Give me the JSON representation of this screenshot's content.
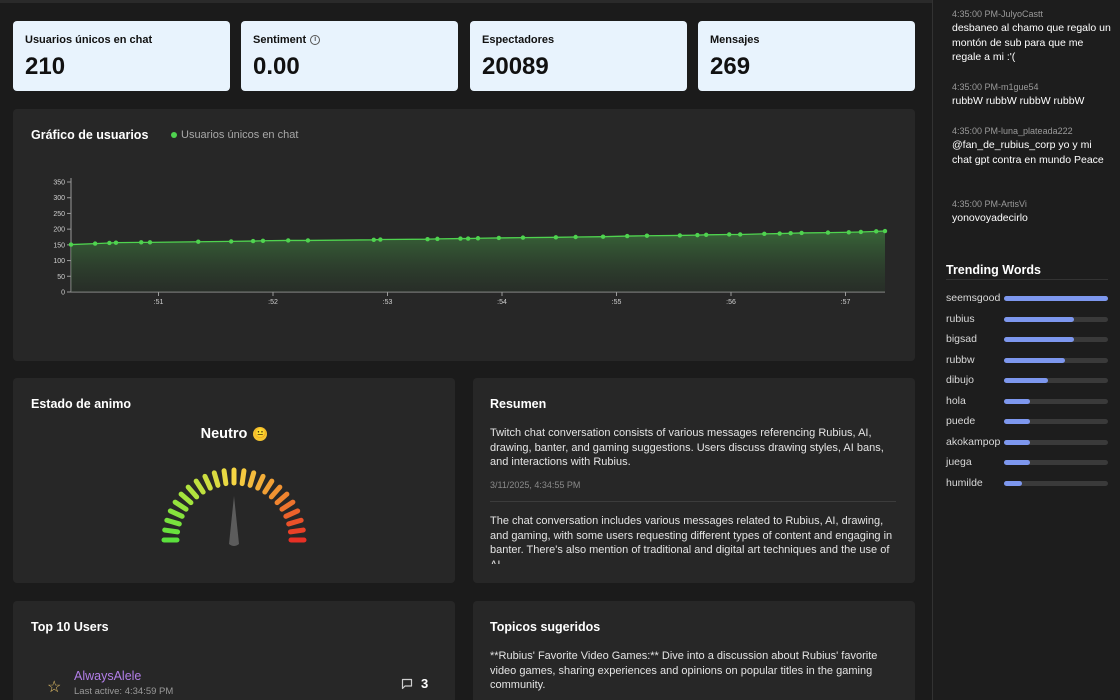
{
  "stats": [
    {
      "label": "Usuarios únicos en chat",
      "value": "210"
    },
    {
      "label": "Sentiment",
      "value": "0.00",
      "icon": "info-icon"
    },
    {
      "label": "Espectadores",
      "value": "20089"
    },
    {
      "label": "Mensajes",
      "value": "269"
    }
  ],
  "users_chart": {
    "title": "Gráfico de usuarios",
    "legend": "Usuarios únicos en chat"
  },
  "chart_data": {
    "type": "area",
    "title": "Gráfico de usuarios",
    "series": [
      {
        "name": "Usuarios únicos en chat",
        "color": "#4fd34f"
      }
    ],
    "y_ticks": [
      "350",
      "300",
      "250",
      "200",
      "150",
      "100",
      "50",
      "0"
    ],
    "x_ticks": [
      ":51",
      ":52",
      ":53",
      ":54",
      ":55",
      ":56",
      ":57"
    ],
    "ylim": [
      0,
      350
    ],
    "x": [
      0.0,
      0.22,
      0.35,
      0.41,
      0.64,
      0.72,
      1.16,
      1.46,
      1.66,
      1.75,
      1.98,
      2.16,
      2.76,
      2.82,
      3.25,
      3.34,
      3.55,
      3.62,
      3.71,
      3.9,
      4.12,
      4.42,
      4.6,
      4.85,
      5.07,
      5.25,
      5.55,
      5.71,
      5.79,
      6.0,
      6.1,
      6.32,
      6.46,
      6.56,
      6.66,
      6.9,
      7.09,
      7.2,
      7.34,
      7.42
    ],
    "values": [
      151,
      154,
      156,
      157,
      158,
      158,
      160,
      161,
      162,
      163,
      164,
      164,
      166,
      167,
      168,
      169,
      170,
      170,
      171,
      172,
      173,
      174,
      175,
      176,
      178,
      179,
      180,
      181,
      182,
      183,
      183,
      185,
      186,
      187,
      188,
      189,
      190,
      191,
      193,
      194
    ],
    "x_start_label": ":51",
    "x_unit": "minutes past 4:50"
  },
  "mood": {
    "title": "Estado de animo",
    "label": "Neutro",
    "emoji": "😐"
  },
  "summary": {
    "title": "Resumen",
    "items": [
      {
        "text": "Twitch chat conversation consists of various messages referencing Rubius, AI, drawing, banter, and gaming suggestions. Users discuss drawing styles, AI bans, and interactions with Rubius.",
        "date": "3/11/2025, 4:34:55 PM"
      },
      {
        "text": "The chat conversation includes various messages related to Rubius, AI, drawing, and gaming, with some users requesting different types of content and engaging in banter. There's also mention of traditional and digital art techniques and the use of AI."
      }
    ]
  },
  "top_users": {
    "title": "Top 10 Users",
    "users": [
      {
        "name": "AlwaysAlele",
        "last_active": "Last active: 4:34:59 PM",
        "count": "3"
      }
    ]
  },
  "topics": {
    "title": "Topicos sugeridos",
    "text": "**Rubius' Favorite Video Games:** Dive into a discussion about Rubius' favorite video games, sharing experiences and opinions on popular titles in the gaming community."
  },
  "chat": [
    {
      "meta": "4:35:00 PM-JulyoCastt",
      "text": "desbaneo al chamo que regalo un montón de sub para que me regale a mi :'("
    },
    {
      "meta": "4:35:00 PM-m1gue54",
      "text": "rubbW rubbW rubbW rubbW"
    },
    {
      "meta": "4:35:00 PM-luna_plateada222",
      "text": "@fan_de_rubius_corp yo y mi chat gpt contra en mundo Peace"
    },
    {
      "meta": "4:35:00 PM-ArtisVi",
      "text": "yonovoyadecirlo"
    }
  ],
  "trending": {
    "title": "Trending Words",
    "words": [
      {
        "word": "seemsgood",
        "level": 1.0
      },
      {
        "word": "rubius",
        "level": 0.67
      },
      {
        "word": "bigsad",
        "level": 0.67
      },
      {
        "word": "rubbw",
        "level": 0.59
      },
      {
        "word": "dibujo",
        "level": 0.42
      },
      {
        "word": "hola",
        "level": 0.25
      },
      {
        "word": "puede",
        "level": 0.25
      },
      {
        "word": "akokampop",
        "level": 0.25
      },
      {
        "word": "juega",
        "level": 0.25
      },
      {
        "word": "humilde",
        "level": 0.17
      }
    ],
    "bar_color": "#7d97ee"
  }
}
